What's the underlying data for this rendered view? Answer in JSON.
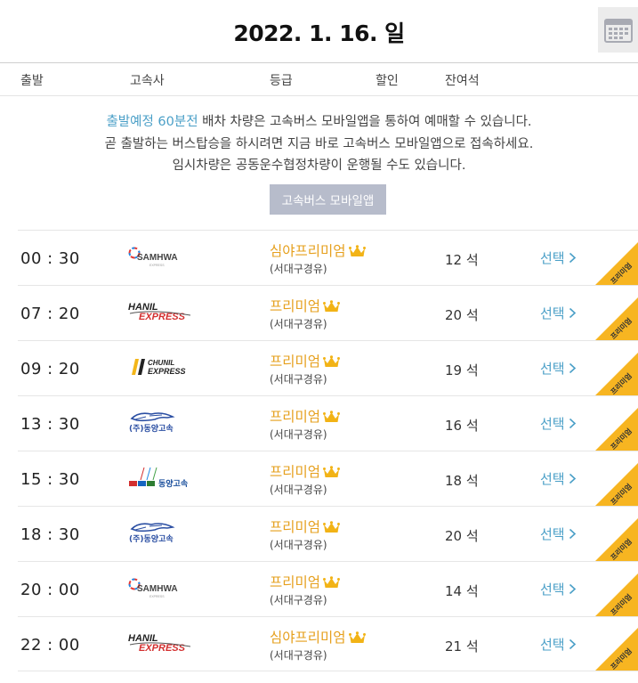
{
  "header": {
    "date": "2022. 1. 16. 일"
  },
  "columns": {
    "depart": "출발",
    "company": "고속사",
    "grade": "등급",
    "discount": "할인",
    "seats": "잔여석"
  },
  "notice": {
    "highlight": "출발예정 60분전",
    "line1_rest": " 배차 차량은 고속버스 모바일앱을 통하여 예매할 수 있습니다.",
    "line2": "곧 출발하는 버스탑승을 하시려면 지금 바로 고속버스 모바일앱으로 접속하세요.",
    "line3": "임시차량은 공동운수협정차량이 운행될 수도 있습니다.",
    "button": "고속버스 모바일앱"
  },
  "colors": {
    "accent": "#4a9fc7",
    "grade": "#e6a01e",
    "ribbon": "#f7b521",
    "button_bg": "#b7bccb"
  },
  "schedules": [
    {
      "time": "00 : 30",
      "company": "SAMHWA",
      "grade": "심야프리미엄",
      "route": "(서대구경유)",
      "seats": "12 석",
      "select": "선택",
      "badge": "프리미엄"
    },
    {
      "time": "07 : 20",
      "company": "HANIL EXPRESS",
      "grade": "프리미엄",
      "route": "(서대구경유)",
      "seats": "20 석",
      "select": "선택",
      "badge": "프리미엄"
    },
    {
      "time": "09 : 20",
      "company": "CHUNIL EXPRESS",
      "grade": "프리미엄",
      "route": "(서대구경유)",
      "seats": "19 석",
      "select": "선택",
      "badge": "프리미엄"
    },
    {
      "time": "13 : 30",
      "company": "(주)동양고속",
      "grade": "프리미엄",
      "route": "(서대구경유)",
      "seats": "16 석",
      "select": "선택",
      "badge": "프리미엄"
    },
    {
      "time": "15 : 30",
      "company": "동양고속",
      "grade": "프리미엄",
      "route": "(서대구경유)",
      "seats": "18 석",
      "select": "선택",
      "badge": "프리미엄"
    },
    {
      "time": "18 : 30",
      "company": "(주)동양고속",
      "grade": "프리미엄",
      "route": "(서대구경유)",
      "seats": "20 석",
      "select": "선택",
      "badge": "프리미엄"
    },
    {
      "time": "20 : 00",
      "company": "SAMHWA",
      "grade": "프리미엄",
      "route": "(서대구경유)",
      "seats": "14 석",
      "select": "선택",
      "badge": "프리미엄"
    },
    {
      "time": "22 : 00",
      "company": "HANIL EXPRESS",
      "grade": "심야프리미엄",
      "route": "(서대구경유)",
      "seats": "21 석",
      "select": "선택",
      "badge": "프리미엄"
    }
  ]
}
